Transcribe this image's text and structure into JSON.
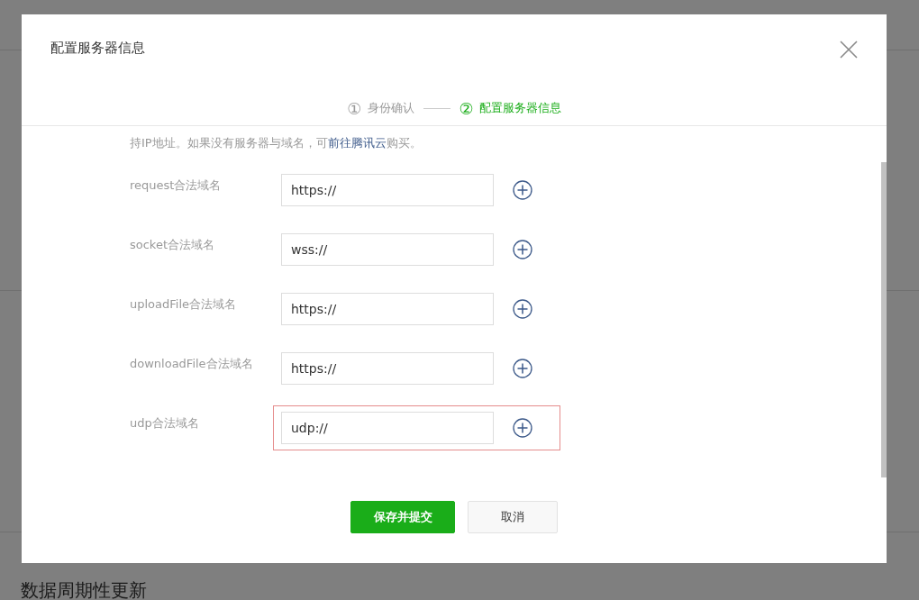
{
  "background": {
    "section_title": "数据周期性更新"
  },
  "dialog": {
    "title": "配置服务器信息",
    "steps": [
      {
        "number": "①",
        "label": "身份确认",
        "selected": false
      },
      {
        "number": "②",
        "label": "配置服务器信息",
        "selected": true
      }
    ],
    "notice": {
      "text": "持IP地址。如果没有服务器与域名，可",
      "link": "前往腾讯云",
      "after": "购买。"
    },
    "fields": [
      {
        "label": "request合法域名",
        "value": "https://",
        "highlighted": false
      },
      {
        "label": "socket合法域名",
        "value": "wss://",
        "highlighted": false
      },
      {
        "label": "uploadFile合法域名",
        "value": "https://",
        "highlighted": false
      },
      {
        "label": "downloadFile合法域名",
        "value": "https://",
        "highlighted": false
      },
      {
        "label": "udp合法域名",
        "value": "udp://",
        "highlighted": true
      }
    ],
    "buttons": [
      {
        "label": "保存并提交",
        "kind": "primary"
      },
      {
        "label": "取消",
        "kind": "secondary"
      }
    ]
  }
}
